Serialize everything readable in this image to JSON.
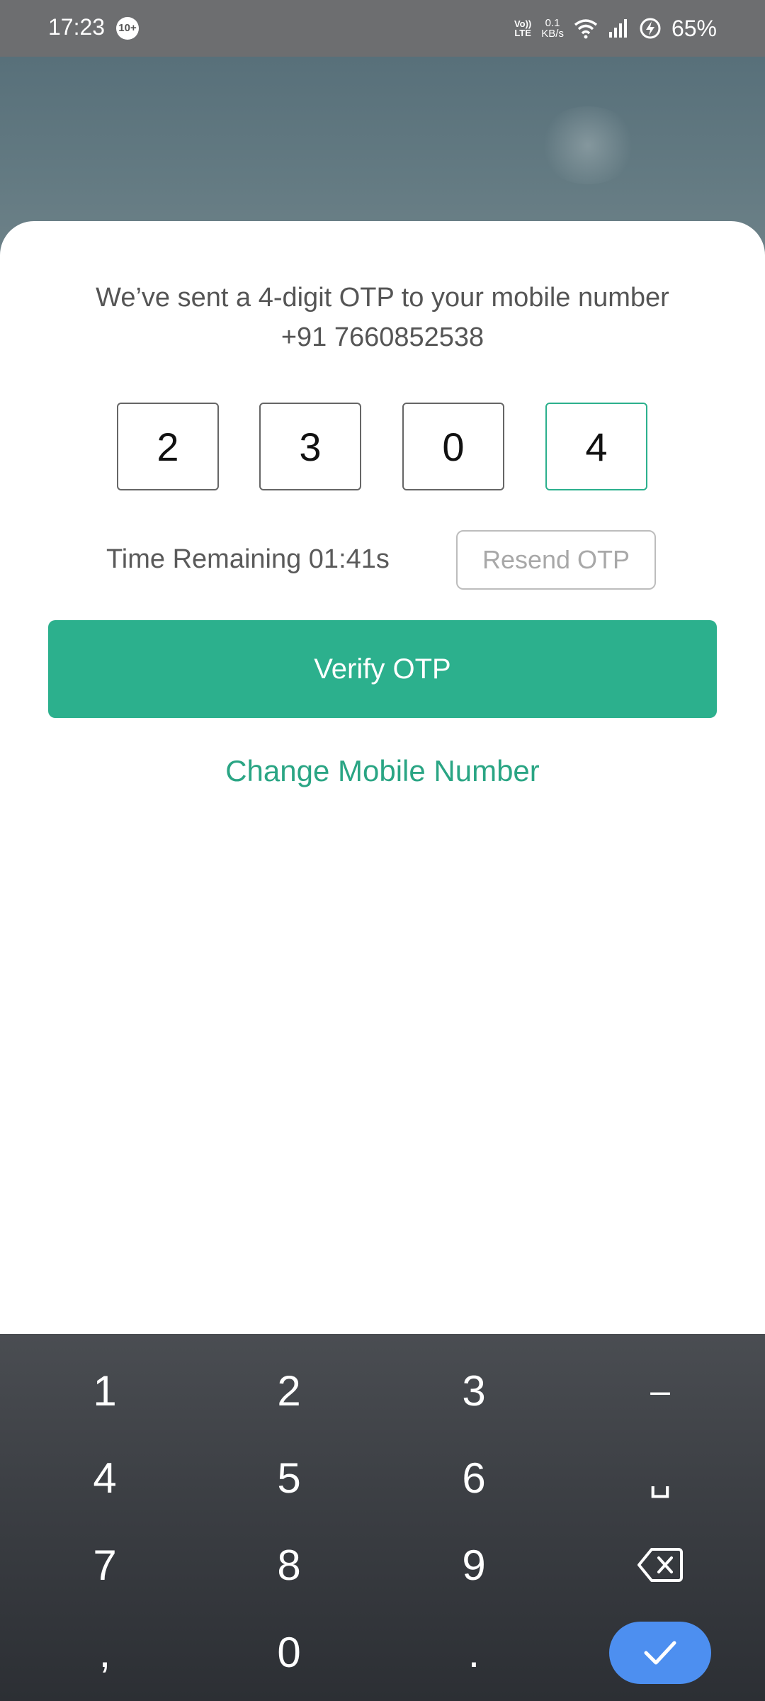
{
  "status_bar": {
    "time": "17:23",
    "notification_badge": "10+",
    "volte_top": "Vo))",
    "volte_bottom": "LTE",
    "speed_value": "0.1",
    "speed_unit": "KB/s",
    "battery": "65%"
  },
  "otp": {
    "message_line1": "We’ve sent a 4-digit OTP to your mobile number",
    "message_line2": "+91 7660852538",
    "digits": [
      "2",
      "3",
      "0",
      "4"
    ],
    "timer": "Time Remaining 01:41s",
    "resend_label": "Resend OTP",
    "verify_label": "Verify OTP",
    "change_label": "Change Mobile Number"
  },
  "keyboard": {
    "row1": [
      "1",
      "2",
      "3",
      "–"
    ],
    "row2": [
      "4",
      "5",
      "6",
      "␣"
    ],
    "row3": [
      "7",
      "8",
      "9"
    ],
    "row4": [
      ",",
      "0",
      "."
    ]
  },
  "colors": {
    "accent": "#2cb08d",
    "done_key": "#4d8ff0"
  }
}
